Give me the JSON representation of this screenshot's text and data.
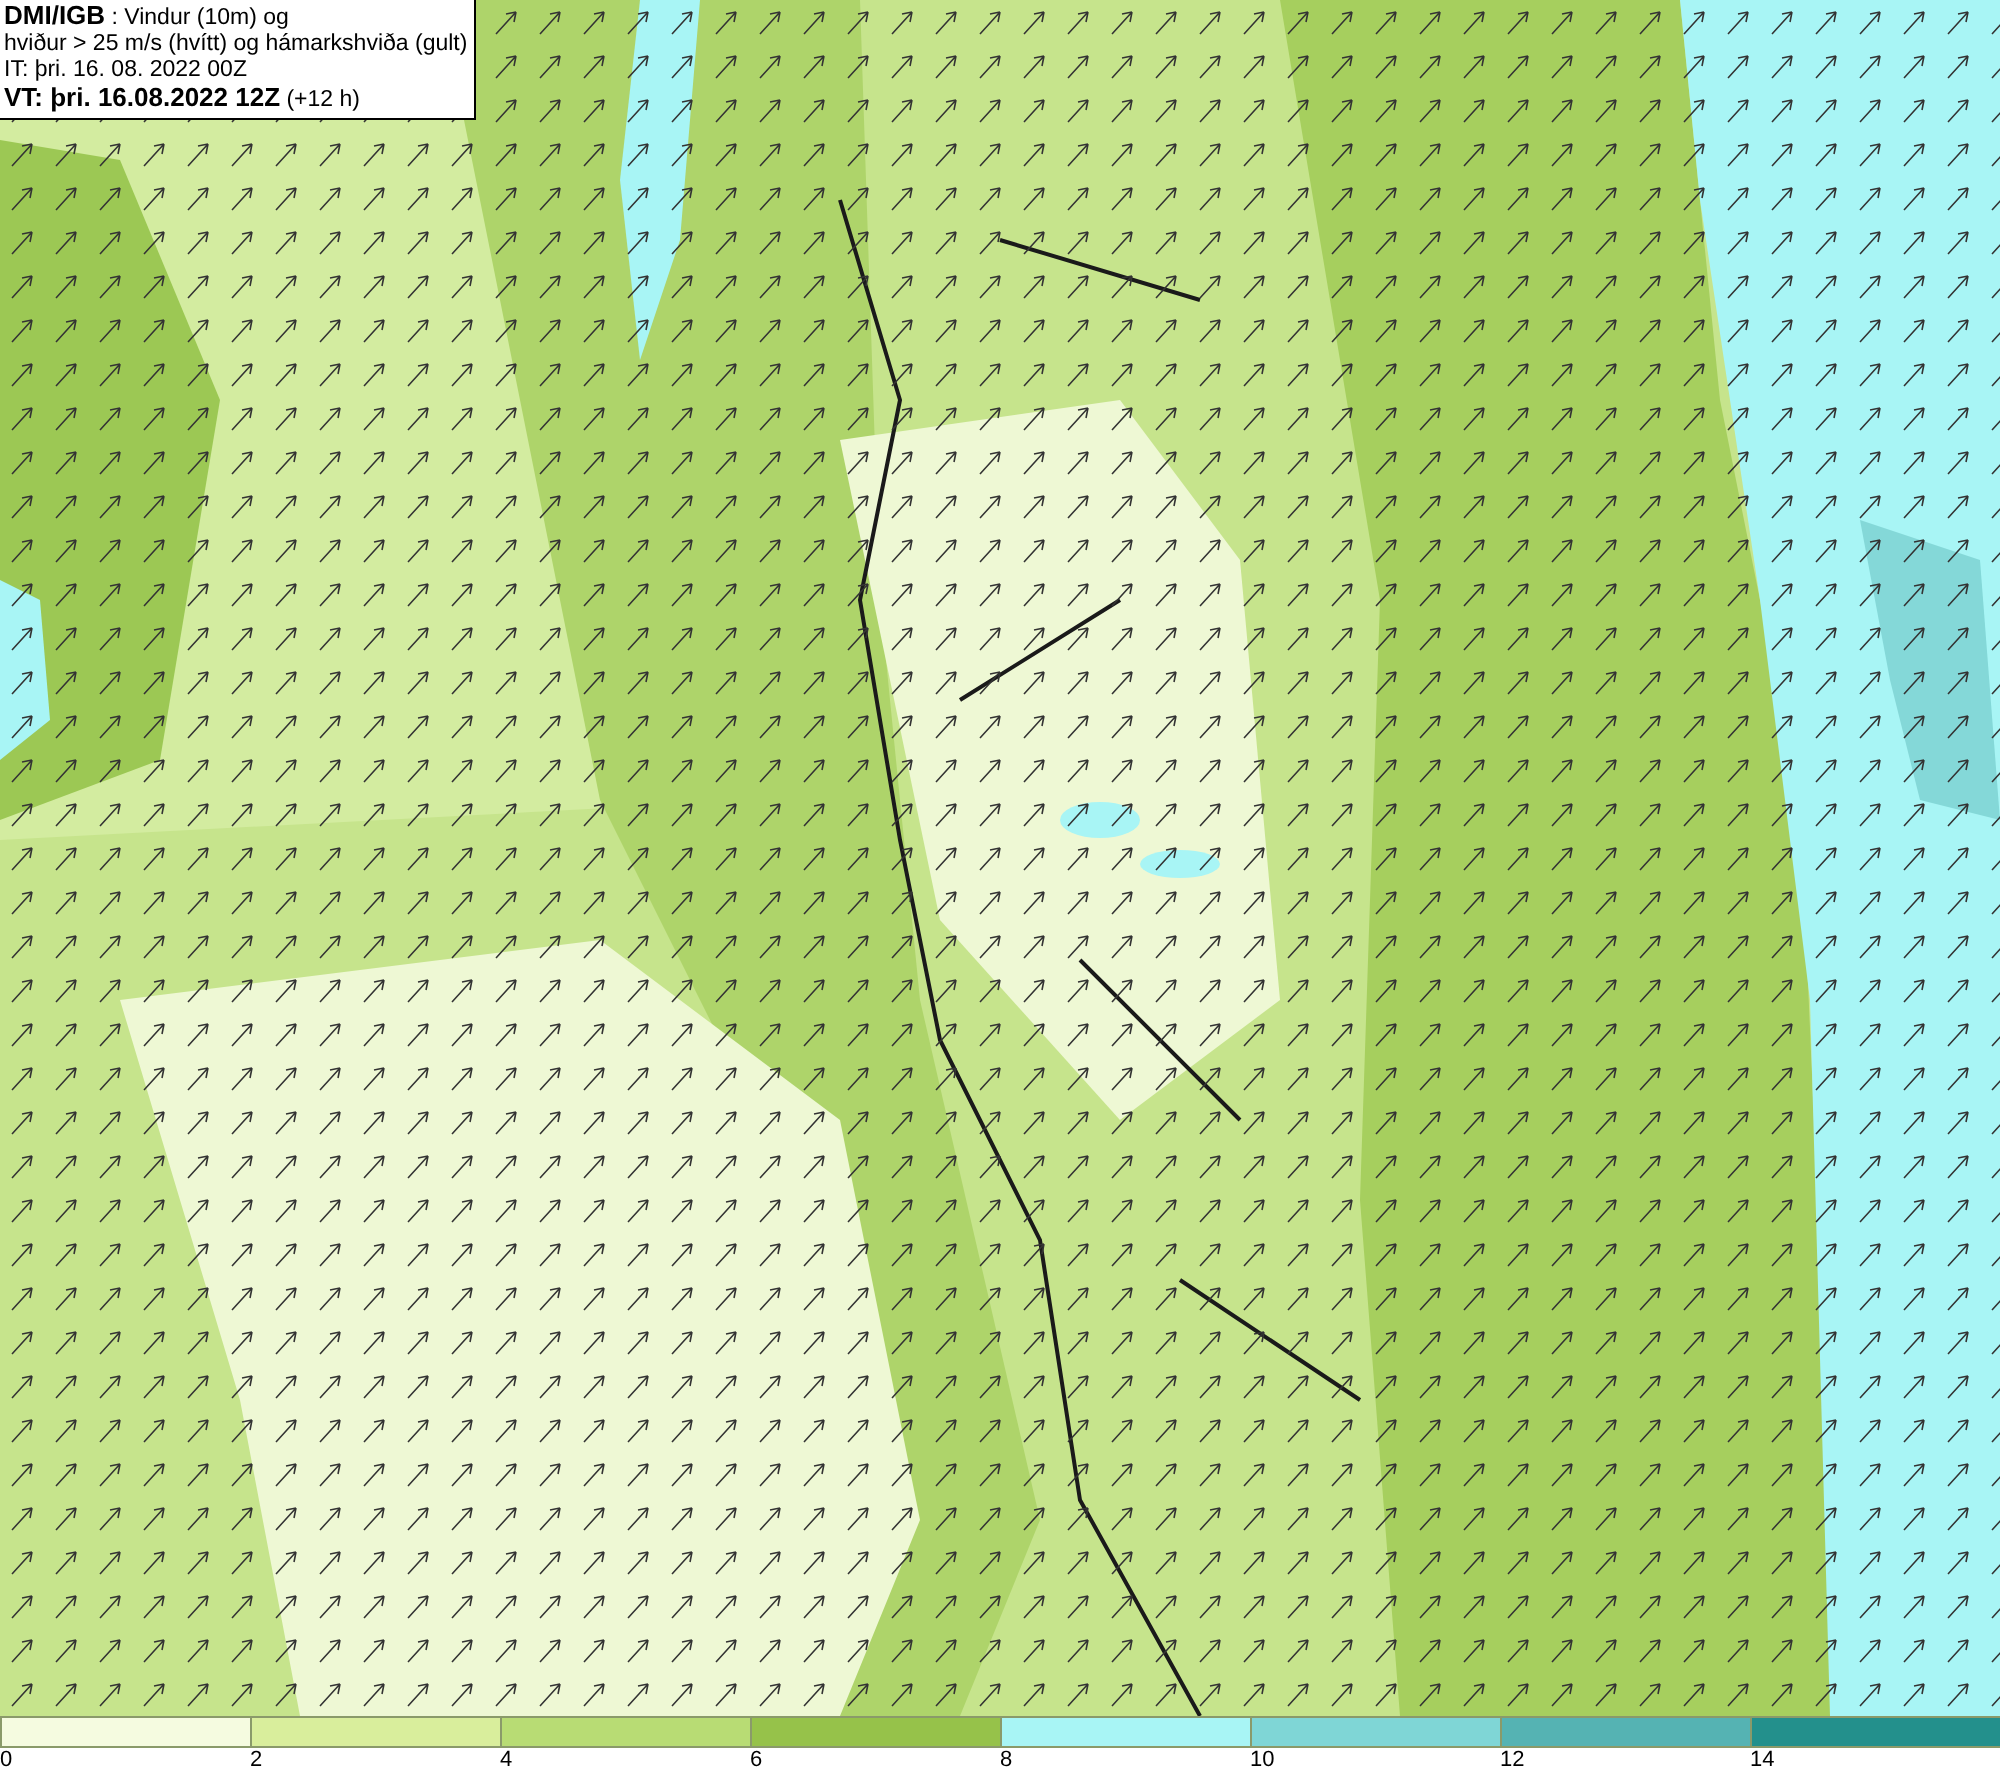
{
  "header": {
    "lines": [
      "**DMI/IGB** : Vindur (10m) og",
      "hviður > 25 m/s (hvítt) og hámarkshviða (gult)",
      "IT: þri. 16. 08. 2022 00Z",
      "**VT: þri. 16.08.2022 12Z** (+12 h)"
    ]
  },
  "legend": [
    {
      "label": "0",
      "color": "#f5fbe0"
    },
    {
      "label": "2",
      "color": "#d9ee9c"
    },
    {
      "label": "4",
      "color": "#b8dc74"
    },
    {
      "label": "6",
      "color": "#96c24a"
    },
    {
      "label": "8",
      "color": "#a8f5f5"
    },
    {
      "label": "10",
      "color": "#7fd6d6"
    },
    {
      "label": "12",
      "color": "#55b3b3"
    },
    {
      "label": "14",
      "color": "#23908c"
    }
  ]
}
